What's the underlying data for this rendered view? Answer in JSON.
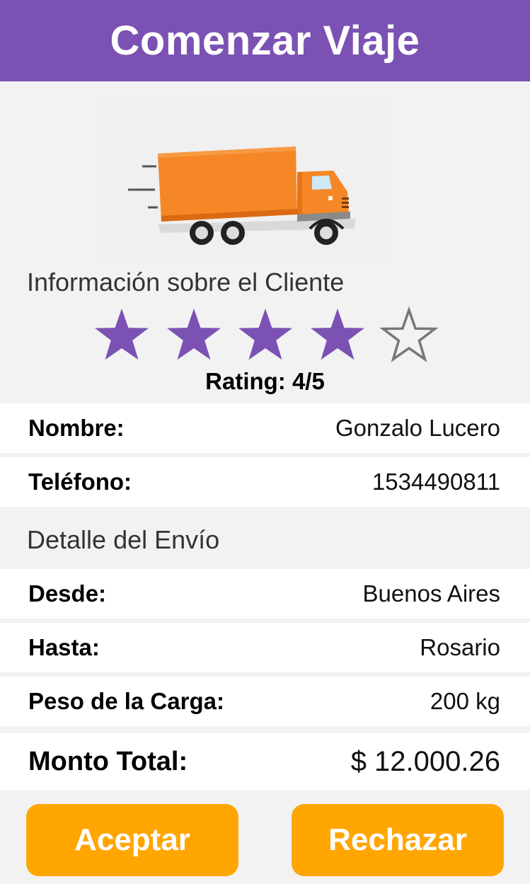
{
  "header": {
    "title": "Comenzar Viaje"
  },
  "client_section": {
    "title": "Información sobre el Cliente"
  },
  "rating": {
    "value": 4,
    "max": 5,
    "label": "Rating: 4/5",
    "star_color": "#7b52b3"
  },
  "client": {
    "name_label": "Nombre:",
    "name_value": "Gonzalo Lucero",
    "phone_label": "Teléfono:",
    "phone_value": "1534490811"
  },
  "shipment_section": {
    "title": "Detalle del Envío"
  },
  "shipment": {
    "from_label": "Desde:",
    "from_value": "Buenos Aires",
    "to_label": "Hasta:",
    "to_value": "Rosario",
    "weight_label": "Peso de la Carga:",
    "weight_value": "200 kg"
  },
  "total": {
    "label": "Monto Total:",
    "value": "$ 12.000.26"
  },
  "actions": {
    "accept_label": "Aceptar",
    "reject_label": "Rechazar"
  },
  "colors": {
    "header": "#7b52b3",
    "button": "#ffa603",
    "truck": "#f58726"
  },
  "icons": {
    "hero": "truck-icon",
    "star_filled": "star-filled-icon",
    "star_empty": "star-empty-icon"
  }
}
